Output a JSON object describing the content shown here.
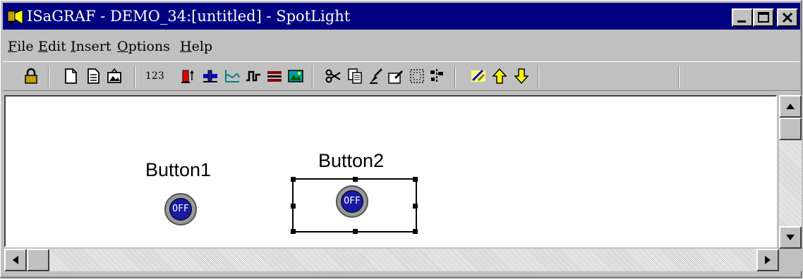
{
  "window": {
    "title": "ISaGRAF - DEMO_34:[untitled] - SpotLight"
  },
  "menu": [
    {
      "pre": "",
      "u": "F",
      "post": "ile"
    },
    {
      "pre": "",
      "u": "E",
      "post": "dit"
    },
    {
      "pre": "",
      "u": "I",
      "post": "nsert"
    },
    {
      "pre": "",
      "u": "O",
      "post": "ptions"
    },
    {
      "pre": "",
      "u": "H",
      "post": "elp"
    }
  ],
  "toolbar": {
    "numeric_label": "123"
  },
  "canvas": {
    "widgets": [
      {
        "label": "Button1",
        "state": "OFF",
        "selected": false
      },
      {
        "label": "Button2",
        "state": "OFF",
        "selected": true
      }
    ]
  },
  "colors": {
    "title_bg": "#000080",
    "button_face": "#1a1aa0",
    "chrome": "#c0c0c0"
  }
}
